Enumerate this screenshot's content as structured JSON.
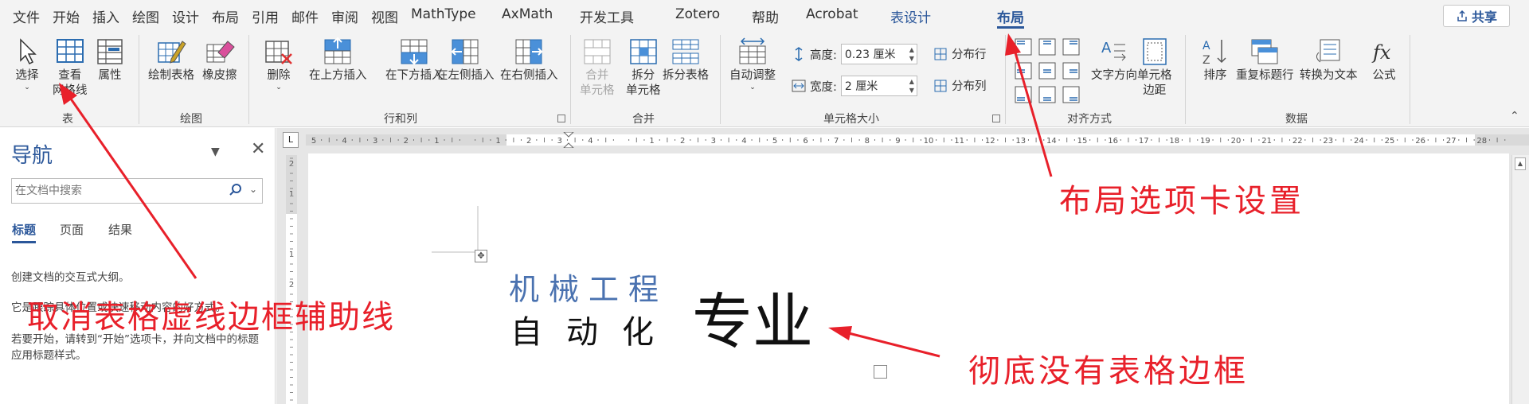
{
  "menu": {
    "tabs": [
      "文件",
      "开始",
      "插入",
      "绘图",
      "设计",
      "布局",
      "引用",
      "邮件",
      "审阅",
      "视图",
      "MathType",
      "AxMath",
      "开发工具",
      "Zotero",
      "帮助",
      "Acrobat",
      "表设计",
      "布局"
    ],
    "active_index": 17,
    "share_label": "共享"
  },
  "ribbon": {
    "table_group": {
      "label": "表",
      "select": "选择",
      "view_grid_1": "查看",
      "view_grid_2": "网格线",
      "properties": "属性"
    },
    "draw_group": {
      "label": "绘图",
      "draw_table": "绘制表格",
      "eraser": "橡皮擦"
    },
    "rows_cols_group": {
      "label": "行和列",
      "delete": "删除",
      "insert_above": "在上方插入",
      "insert_below": "在下方插入",
      "insert_left": "在左侧插入",
      "insert_right": "在右侧插入"
    },
    "merge_group": {
      "label": "合并",
      "merge_1": "合并",
      "merge_2": "单元格",
      "split_cells_1": "拆分",
      "split_cells_2": "单元格",
      "split_table": "拆分表格"
    },
    "cell_size_group": {
      "label": "单元格大小",
      "autofit": "自动调整",
      "height_label": "高度:",
      "height_value": "0.23 厘米",
      "width_label": "宽度:",
      "width_value": "2 厘米",
      "distribute_rows": "分布行",
      "distribute_cols": "分布列"
    },
    "alignment_group": {
      "label": "对齐方式",
      "text_direction": "文字方向",
      "cell_margins_1": "单元格",
      "cell_margins_2": "边距"
    },
    "data_group": {
      "label": "数据",
      "sort": "排序",
      "repeat_header": "重复标题行",
      "convert_text": "转换为文本",
      "formula": "公式"
    }
  },
  "nav_pane": {
    "title": "导航",
    "search_placeholder": "在文档中搜索",
    "tabs": [
      "标题",
      "页面",
      "结果"
    ],
    "para1": "创建文档的交互式大纲。",
    "para2": "它是跟踪具体位置或快速移动内容的好方式。",
    "para3": "若要开始，请转到“开始”选项卡，并向文档中的标题应用标题样式。"
  },
  "ruler": {
    "numbers": [
      "5",
      "4",
      "3",
      "2",
      "1",
      "",
      "1",
      "2",
      "3",
      "4",
      "",
      "1",
      "2",
      "3",
      "4",
      "5",
      "6",
      "7",
      "8",
      "9",
      "10",
      "11",
      "12",
      "13",
      "14",
      "15",
      "16",
      "17",
      "18",
      "19",
      "20",
      "21",
      "22",
      "23",
      "24",
      "25",
      "26",
      "27",
      "28"
    ],
    "vertical_numbers": [
      "2",
      "1",
      "",
      "1",
      "2"
    ]
  },
  "document": {
    "line1": "机械工程",
    "line2": "自动化",
    "big": "专业"
  },
  "annotations": {
    "layout_tab": "布局选项卡设置",
    "gridlines": "取消表格虚线边框辅助线",
    "no_border": "彻底没有表格边框"
  },
  "colors": {
    "accent": "#2b579a",
    "annotation_red": "#e8202a",
    "doc_blue": "#4a72b0"
  }
}
